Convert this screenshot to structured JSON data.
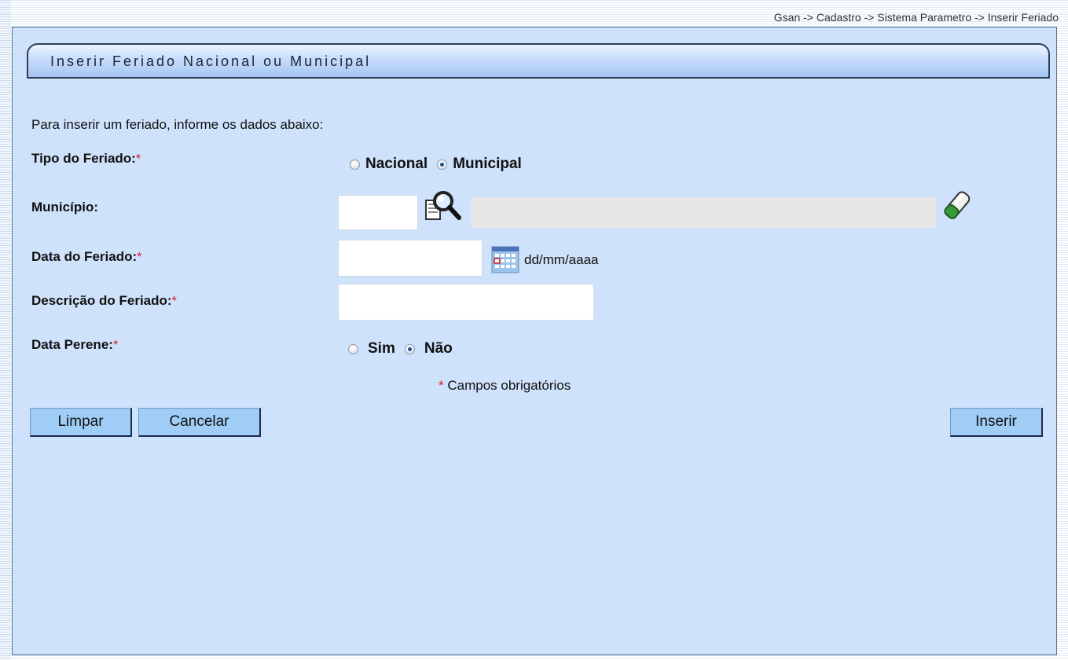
{
  "breadcrumb": "Gsan -> Cadastro -> Sistema Parametro -> Inserir Feriado",
  "title": "Inserir Feriado Nacional ou Municipal",
  "intro": "Para inserir um feriado, informe os dados abaixo:",
  "required_mark": "*",
  "fields": {
    "tipo": {
      "label": "Tipo do Feriado:",
      "options": [
        "Nacional",
        "Municipal"
      ],
      "selected": "Municipal"
    },
    "municipio": {
      "label": "Município:",
      "code_value": "",
      "name_value": ""
    },
    "data": {
      "label": "Data do Feriado:",
      "value": "",
      "hint": "dd/mm/aaaa"
    },
    "descricao": {
      "label": "Descrição do Feriado:",
      "value": ""
    },
    "perene": {
      "label": "Data Perene:",
      "options": [
        "Sim",
        "Não"
      ],
      "selected": "Não"
    }
  },
  "required_note": "Campos obrigatórios",
  "buttons": {
    "limpar": "Limpar",
    "cancelar": "Cancelar",
    "inserir": "Inserir"
  },
  "icons": [
    "search-icon",
    "eraser-icon",
    "calendar-icon"
  ]
}
